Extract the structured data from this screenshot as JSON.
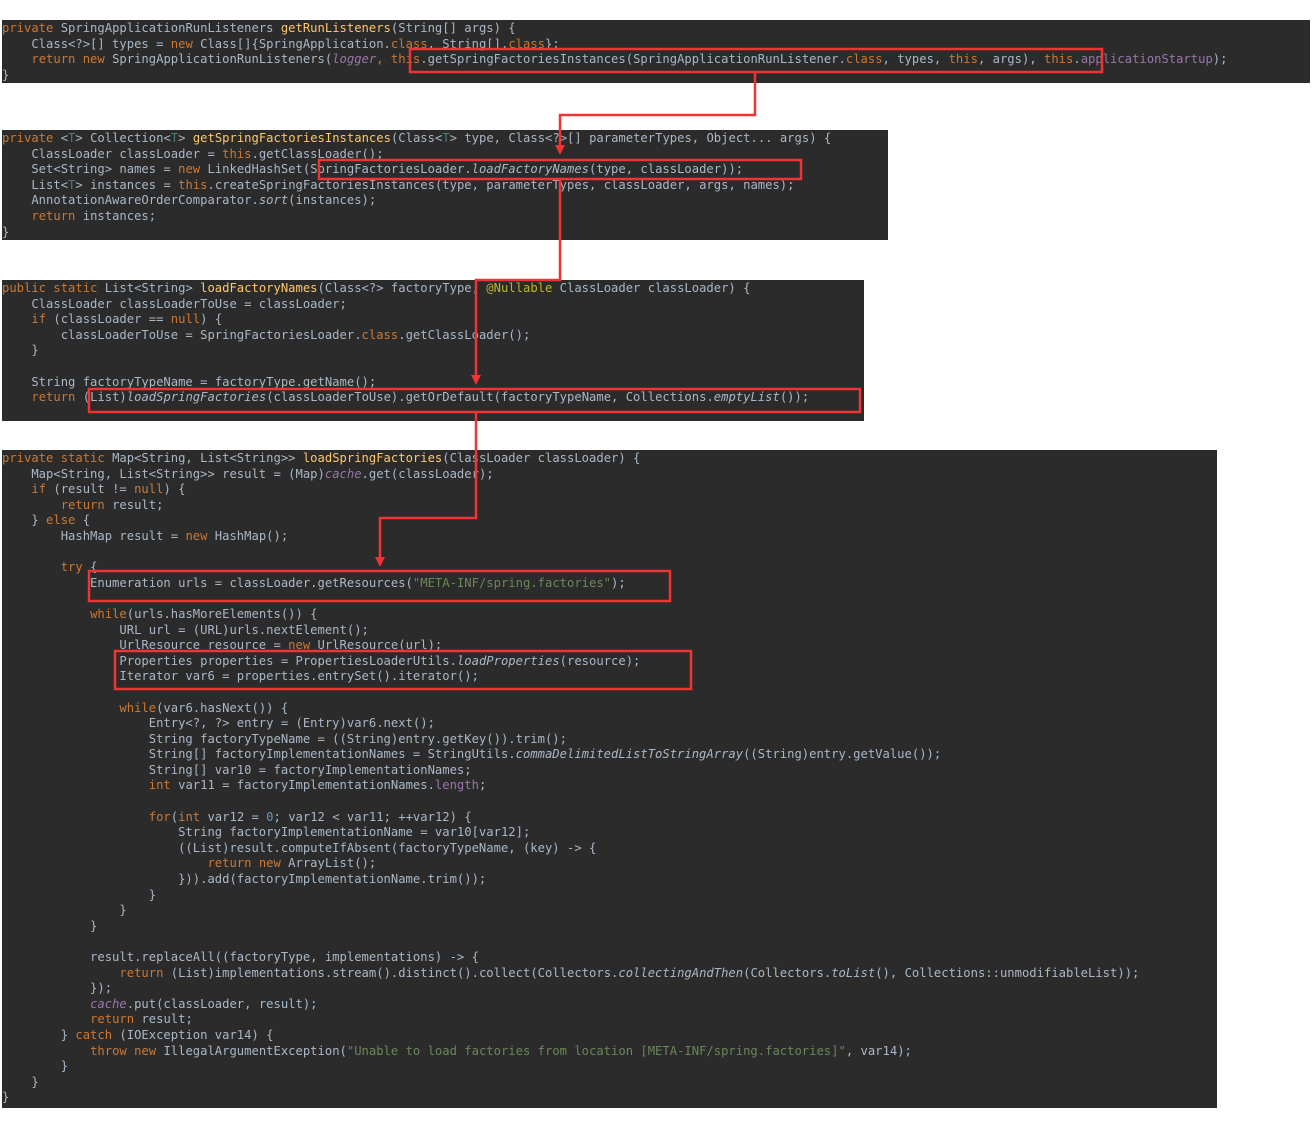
{
  "colors": {
    "background": "#ffffff",
    "editor_bg": "#2b2b2b",
    "text": "#a9b7c6",
    "keyword": "#cc7832",
    "method": "#ffc66d",
    "field": "#9876aa",
    "string": "#6a8759",
    "number": "#6897bb",
    "annotation": "#bbb529",
    "highlight": "#f03333"
  },
  "blocks": [
    {
      "lines": [
        [
          [
            "kw",
            "private "
          ],
          [
            "t",
            "SpringApplicationRunListeners "
          ],
          [
            "fn",
            "getRunListeners"
          ],
          [
            "t",
            "(String[] args) {"
          ]
        ],
        [
          [
            "t",
            "    Class<?>[] types = "
          ],
          [
            "kw",
            "new "
          ],
          [
            "t",
            "Class[]{SpringApplication."
          ],
          [
            "kw",
            "class"
          ],
          [
            "t",
            ", String[]."
          ],
          [
            "kw",
            "class"
          ],
          [
            "t",
            "};"
          ]
        ],
        [
          [
            "t",
            "    "
          ],
          [
            "kw",
            "return new "
          ],
          [
            "t",
            "SpringApplicationRunListeners("
          ],
          [
            "fldi",
            "logger"
          ],
          [
            "kw",
            ", "
          ],
          [
            "kw",
            "this"
          ],
          [
            "t",
            ".getSpringFactoriesInstances(SpringApplicationRunListener."
          ],
          [
            "kw",
            "class"
          ],
          [
            "t",
            ", types, "
          ],
          [
            "kw",
            "this"
          ],
          [
            "t",
            ", args), "
          ],
          [
            "kw",
            "this"
          ],
          [
            "t",
            "."
          ],
          [
            "fld",
            "applicationStartup"
          ],
          [
            "t",
            ");"
          ]
        ],
        [
          [
            "t",
            "}"
          ]
        ]
      ]
    },
    {
      "lines": [
        [
          [
            "kw",
            "private "
          ],
          [
            "t",
            "<"
          ],
          [
            "tp",
            "T"
          ],
          [
            "t",
            "> Collection<"
          ],
          [
            "tp",
            "T"
          ],
          [
            "t",
            "> "
          ],
          [
            "fn",
            "getSpringFactoriesInstances"
          ],
          [
            "t",
            "(Class<"
          ],
          [
            "tp",
            "T"
          ],
          [
            "t",
            "> type, Class<?>[] parameterTypes, Object... args) {"
          ]
        ],
        [
          [
            "t",
            "    ClassLoader classLoader = "
          ],
          [
            "kw",
            "this"
          ],
          [
            "t",
            ".getClassLoader();"
          ]
        ],
        [
          [
            "t",
            "    Set<String> names = "
          ],
          [
            "kw",
            "new "
          ],
          [
            "t",
            "LinkedHashSet(SpringFactoriesLoader."
          ],
          [
            "it",
            "loadFactoryNames"
          ],
          [
            "t",
            "(type, classLoader));"
          ]
        ],
        [
          [
            "t",
            "    List<"
          ],
          [
            "tp",
            "T"
          ],
          [
            "t",
            "> instances = "
          ],
          [
            "kw",
            "this"
          ],
          [
            "t",
            ".createSpringFactoriesInstances(type, parameterTypes, classLoader, args, names);"
          ]
        ],
        [
          [
            "t",
            "    AnnotationAwareOrderComparator."
          ],
          [
            "it",
            "sort"
          ],
          [
            "t",
            "(instances);"
          ]
        ],
        [
          [
            "t",
            "    "
          ],
          [
            "kw",
            "return "
          ],
          [
            "t",
            "instances;"
          ]
        ],
        [
          [
            "t",
            "}"
          ]
        ]
      ]
    },
    {
      "lines": [
        [
          [
            "kw",
            "public static "
          ],
          [
            "t",
            "List<String> "
          ],
          [
            "fn",
            "loadFactoryNames"
          ],
          [
            "t",
            "(Class<?> factoryType, "
          ],
          [
            "ann",
            "@Nullable "
          ],
          [
            "t",
            "ClassLoader classLoader) {"
          ]
        ],
        [
          [
            "t",
            "    ClassLoader classLoaderToUse = classLoader;"
          ]
        ],
        [
          [
            "t",
            "    "
          ],
          [
            "kw",
            "if "
          ],
          [
            "t",
            "(classLoader == "
          ],
          [
            "kw",
            "null"
          ],
          [
            "t",
            ") {"
          ]
        ],
        [
          [
            "t",
            "        classLoaderToUse = SpringFactoriesLoader."
          ],
          [
            "kw",
            "class"
          ],
          [
            "t",
            ".getClassLoader();"
          ]
        ],
        [
          [
            "t",
            "    }"
          ]
        ],
        [
          [
            "t",
            ""
          ]
        ],
        [
          [
            "t",
            "    String factoryTypeName = factoryType.getName();"
          ]
        ],
        [
          [
            "t",
            "    "
          ],
          [
            "kw",
            "return "
          ],
          [
            "t",
            "(List)"
          ],
          [
            "it",
            "loadSpringFactories"
          ],
          [
            "t",
            "(classLoaderToUse).getOrDefault(factoryTypeName, Collections."
          ],
          [
            "it",
            "emptyList"
          ],
          [
            "t",
            "());"
          ]
        ]
      ]
    },
    {
      "lines": [
        [
          [
            "kw",
            "private static "
          ],
          [
            "t",
            "Map<String, List<String>> "
          ],
          [
            "fn",
            "loadSpringFactories"
          ],
          [
            "t",
            "(ClassLoader classLoader) {"
          ]
        ],
        [
          [
            "t",
            "    Map<String, List<String>> result = (Map)"
          ],
          [
            "fldi",
            "cache"
          ],
          [
            "t",
            ".get(classLoader);"
          ]
        ],
        [
          [
            "t",
            "    "
          ],
          [
            "kw",
            "if "
          ],
          [
            "t",
            "(result != "
          ],
          [
            "kw",
            "null"
          ],
          [
            "t",
            ") {"
          ]
        ],
        [
          [
            "t",
            "        "
          ],
          [
            "kw",
            "return "
          ],
          [
            "t",
            "result;"
          ]
        ],
        [
          [
            "t",
            "    } "
          ],
          [
            "kw",
            "else "
          ],
          [
            "t",
            "{"
          ]
        ],
        [
          [
            "t",
            "        HashMap result = "
          ],
          [
            "kw",
            "new "
          ],
          [
            "t",
            "HashMap();"
          ]
        ],
        [
          [
            "t",
            ""
          ]
        ],
        [
          [
            "t",
            "        "
          ],
          [
            "kw",
            "try "
          ],
          [
            "t",
            "{"
          ]
        ],
        [
          [
            "t",
            "            Enumeration urls = classLoader.getResources("
          ],
          [
            "str",
            "\"META-INF/spring.factories\""
          ],
          [
            "t",
            ");"
          ]
        ],
        [
          [
            "t",
            ""
          ]
        ],
        [
          [
            "t",
            "            "
          ],
          [
            "kw",
            "while"
          ],
          [
            "t",
            "(urls.hasMoreElements()) {"
          ]
        ],
        [
          [
            "t",
            "                URL url = (URL)urls.nextElement();"
          ]
        ],
        [
          [
            "t",
            "                UrlResource resource = "
          ],
          [
            "kw",
            "new "
          ],
          [
            "t",
            "UrlResource(url);"
          ]
        ],
        [
          [
            "t",
            "                Properties properties = PropertiesLoaderUtils."
          ],
          [
            "it",
            "loadProperties"
          ],
          [
            "t",
            "(resource);"
          ]
        ],
        [
          [
            "t",
            "                Iterator var6 = properties.entrySet().iterator();"
          ]
        ],
        [
          [
            "t",
            ""
          ]
        ],
        [
          [
            "t",
            "                "
          ],
          [
            "kw",
            "while"
          ],
          [
            "t",
            "(var6.hasNext()) {"
          ]
        ],
        [
          [
            "t",
            "                    Entry<?, ?> entry = (Entry)var6.next();"
          ]
        ],
        [
          [
            "t",
            "                    String factoryTypeName = ((String)entry.getKey()).trim();"
          ]
        ],
        [
          [
            "t",
            "                    String[] factoryImplementationNames = StringUtils."
          ],
          [
            "it",
            "commaDelimitedListToStringArray"
          ],
          [
            "t",
            "((String)entry.getValue());"
          ]
        ],
        [
          [
            "t",
            "                    String[] var10 = factoryImplementationNames;"
          ]
        ],
        [
          [
            "t",
            "                    "
          ],
          [
            "kw",
            "int "
          ],
          [
            "t",
            "var11 = factoryImplementationNames."
          ],
          [
            "fld",
            "length"
          ],
          [
            "t",
            ";"
          ]
        ],
        [
          [
            "t",
            ""
          ]
        ],
        [
          [
            "t",
            "                    "
          ],
          [
            "kw",
            "for"
          ],
          [
            "t",
            "("
          ],
          [
            "kw",
            "int "
          ],
          [
            "t",
            "var12 = "
          ],
          [
            "num",
            "0"
          ],
          [
            "t",
            "; var12 < var11; ++var12) {"
          ]
        ],
        [
          [
            "t",
            "                        String factoryImplementationName = var10[var12];"
          ]
        ],
        [
          [
            "t",
            "                        ((List)result.computeIfAbsent(factoryTypeName, (key) -> {"
          ]
        ],
        [
          [
            "t",
            "                            "
          ],
          [
            "kw",
            "return new "
          ],
          [
            "t",
            "ArrayList();"
          ]
        ],
        [
          [
            "t",
            "                        })).add(factoryImplementationName.trim());"
          ]
        ],
        [
          [
            "t",
            "                    }"
          ]
        ],
        [
          [
            "t",
            "                }"
          ]
        ],
        [
          [
            "t",
            "            }"
          ]
        ],
        [
          [
            "t",
            ""
          ]
        ],
        [
          [
            "t",
            "            result.replaceAll((factoryType, implementations) -> {"
          ]
        ],
        [
          [
            "t",
            "                "
          ],
          [
            "kw",
            "return "
          ],
          [
            "t",
            "(List)implementations.stream().distinct().collect(Collectors."
          ],
          [
            "it",
            "collectingAndThen"
          ],
          [
            "t",
            "(Collectors."
          ],
          [
            "it",
            "toList"
          ],
          [
            "t",
            "(), Collections::unmodifiableList));"
          ]
        ],
        [
          [
            "t",
            "            });"
          ]
        ],
        [
          [
            "t",
            "            "
          ],
          [
            "fldi",
            "cache"
          ],
          [
            "t",
            ".put(classLoader, result);"
          ]
        ],
        [
          [
            "t",
            "            "
          ],
          [
            "kw",
            "return "
          ],
          [
            "t",
            "result;"
          ]
        ],
        [
          [
            "t",
            "        } "
          ],
          [
            "kw",
            "catch "
          ],
          [
            "t",
            "(IOException var14) {"
          ]
        ],
        [
          [
            "t",
            "            "
          ],
          [
            "kw",
            "throw new "
          ],
          [
            "t",
            "IllegalArgumentException("
          ],
          [
            "str",
            "\"Unable to load factories from location [META-INF/spring.factories]\""
          ],
          [
            "t",
            ", var14);"
          ]
        ],
        [
          [
            "t",
            "        }"
          ]
        ],
        [
          [
            "t",
            "    }"
          ]
        ],
        [
          [
            "t",
            "}"
          ]
        ]
      ]
    }
  ]
}
